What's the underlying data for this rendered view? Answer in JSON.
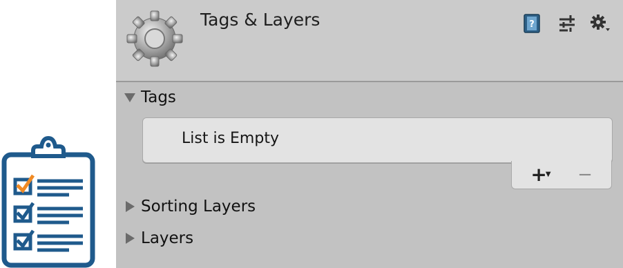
{
  "header": {
    "title": "Tags & Layers",
    "icons": [
      "gear-icon",
      "help-icon",
      "presets-icon",
      "settings-icon"
    ]
  },
  "sections": [
    {
      "label": "Tags",
      "expanded": true
    },
    {
      "label": "Sorting Layers",
      "expanded": false
    },
    {
      "label": "Layers",
      "expanded": false
    }
  ],
  "tags_list": {
    "empty_text": "List is Empty",
    "add_label": "+",
    "remove_label": "−"
  },
  "colors": {
    "header_bg": "#cbcbcb",
    "panel_bg": "#c2c2c2",
    "list_bg": "#e3e3e3",
    "clipboard_blue": "#1f5a8c",
    "check_orange": "#f08a24"
  }
}
